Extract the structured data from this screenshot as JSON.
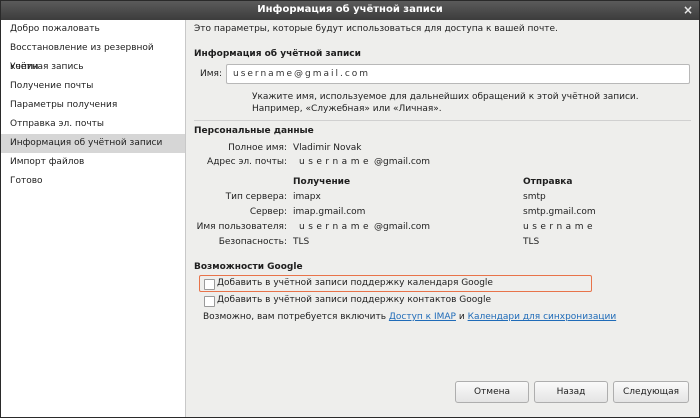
{
  "window": {
    "title": "Информация об учётной записи",
    "close_glyph": "×"
  },
  "sidebar": {
    "items": [
      {
        "label": "Добро пожаловать"
      },
      {
        "label": "Восстановление из резервной копии"
      },
      {
        "label": "Учётная запись"
      },
      {
        "label": "Получение почты"
      },
      {
        "label": "Параметры получения"
      },
      {
        "label": "Отправка эл. почты"
      },
      {
        "label": "Информация об учётной записи",
        "active": true
      },
      {
        "label": "Импорт файлов"
      },
      {
        "label": "Готово"
      }
    ]
  },
  "main": {
    "intro": "Это параметры, которые будут использоваться для доступа к вашей почте.",
    "account_info": {
      "heading": "Информация об учётной записи",
      "name_label": "Имя:",
      "name_value": "username@gmail.com",
      "hint_line1": "Укажите имя, используемое для дальнейших обращений к этой учётной записи.",
      "hint_line2": "Например, «Служебная» или «Личная»."
    },
    "personal": {
      "heading": "Персональные данные",
      "fullname_label": "Полное имя:",
      "fullname_value": "Vladimir Novak",
      "email_label": "Адрес эл. почты:",
      "email_user": "username",
      "email_domain": "@gmail.com"
    },
    "servers": {
      "col_receive": "Получение",
      "col_send": "Отправка",
      "rows": [
        {
          "label": "Тип сервера:",
          "receive": "imapx",
          "send": "smtp"
        },
        {
          "label": "Сервер:",
          "receive": "imap.gmail.com",
          "send": "smtp.gmail.com"
        },
        {
          "label": "Имя пользователя:",
          "receive_user": "username",
          "receive_domain": "@gmail.com",
          "send": "username"
        },
        {
          "label": "Безопасность:",
          "receive": "TLS",
          "send": "TLS"
        }
      ]
    },
    "google": {
      "heading": "Возможности Google",
      "calendar_label": "Добавить в учётной записи поддержку календаря Google",
      "contacts_label": "Добавить в учётной записи поддержку контактов Google",
      "note_prefix": "Возможно, вам потребуется включить",
      "note_link1": "Доступ к IMAP",
      "note_and": "и",
      "note_link2": "Календари для синхронизации"
    }
  },
  "buttons": {
    "cancel": "Отмена",
    "back": "Назад",
    "next": "Следующая"
  },
  "colors": {
    "focus_border": "#e8734a",
    "link": "#1f6bb8",
    "selected_row": "#d6d6d6"
  }
}
